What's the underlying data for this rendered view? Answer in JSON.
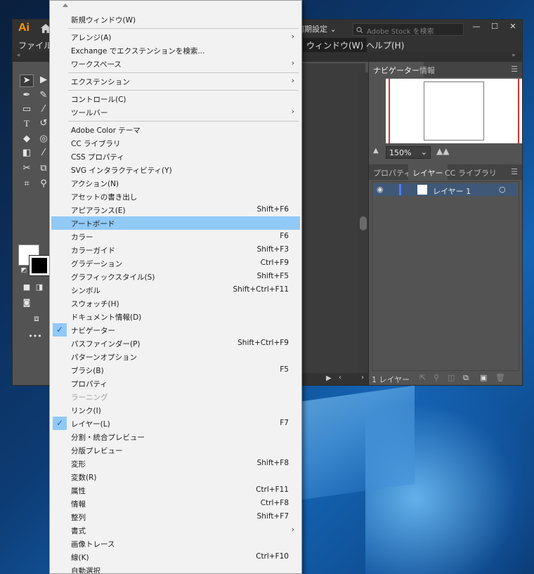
{
  "app": {
    "logo": "Ai",
    "workspace": "初期設定",
    "stock_search_placeholder": "Adobe Stock を検索",
    "menu_file": "ファイル",
    "menu_window": "ウィンドウ(W)",
    "menu_help": "ヘルプ(H)",
    "win_min": "—",
    "win_max": "☐",
    "win_close": "✕"
  },
  "panels": {
    "top_tabs": [
      "ナビゲーター",
      "情報"
    ],
    "zoom": "150%",
    "bottom_tabs": [
      "プロパティ",
      "レイヤー",
      "CC ライブラリ"
    ],
    "layer_name": "レイヤー 1",
    "layer_count": "1 レイヤー"
  },
  "menu": {
    "items": [
      {
        "label": "新規ウィンドウ(W)",
        "shortcut": ""
      },
      {
        "label": "アレンジ(A)",
        "shortcut": "",
        "submenu": true
      },
      {
        "label": "Exchange でエクステンションを検索...",
        "shortcut": ""
      },
      {
        "label": "ワークスペース",
        "shortcut": "",
        "submenu": true
      },
      {
        "label": "エクステンション",
        "shortcut": "",
        "submenu": true
      },
      {
        "label": "コントロール(C)",
        "shortcut": ""
      },
      {
        "label": "ツールバー",
        "shortcut": "",
        "submenu": true
      },
      {
        "label": "Adobe Color テーマ",
        "shortcut": ""
      },
      {
        "label": "CC ライブラリ",
        "shortcut": ""
      },
      {
        "label": "CSS プロパティ",
        "shortcut": ""
      },
      {
        "label": "SVG インタラクティビティ(Y)",
        "shortcut": ""
      },
      {
        "label": "アクション(N)",
        "shortcut": ""
      },
      {
        "label": "アセットの書き出し",
        "shortcut": ""
      },
      {
        "label": "アピアランス(E)",
        "shortcut": "Shift+F6"
      },
      {
        "label": "アートボード",
        "shortcut": "",
        "highlighted": true
      },
      {
        "label": "カラー",
        "shortcut": "F6"
      },
      {
        "label": "カラーガイド",
        "shortcut": "Shift+F3"
      },
      {
        "label": "グラデーション",
        "shortcut": "Ctrl+F9"
      },
      {
        "label": "グラフィックスタイル(S)",
        "shortcut": "Shift+F5"
      },
      {
        "label": "シンボル",
        "shortcut": "Shift+Ctrl+F11"
      },
      {
        "label": "スウォッチ(H)",
        "shortcut": ""
      },
      {
        "label": "ドキュメント情報(D)",
        "shortcut": ""
      },
      {
        "label": "ナビゲーター",
        "shortcut": "",
        "checked": true
      },
      {
        "label": "パスファインダー(P)",
        "shortcut": "Shift+Ctrl+F9"
      },
      {
        "label": "パターンオプション",
        "shortcut": ""
      },
      {
        "label": "ブラシ(B)",
        "shortcut": "F5"
      },
      {
        "label": "プロパティ",
        "shortcut": ""
      },
      {
        "label": "ラーニング",
        "shortcut": "",
        "disabled": true
      },
      {
        "label": "リンク(I)",
        "shortcut": ""
      },
      {
        "label": "レイヤー(L)",
        "shortcut": "F7",
        "checked": true
      },
      {
        "label": "分割・統合プレビュー",
        "shortcut": ""
      },
      {
        "label": "分版プレビュー",
        "shortcut": ""
      },
      {
        "label": "変形",
        "shortcut": "Shift+F8"
      },
      {
        "label": "変数(R)",
        "shortcut": ""
      },
      {
        "label": "属性",
        "shortcut": "Ctrl+F11"
      },
      {
        "label": "情報",
        "shortcut": "Ctrl+F8"
      },
      {
        "label": "整列",
        "shortcut": "Shift+F7"
      },
      {
        "label": "書式",
        "shortcut": "",
        "submenu": true
      },
      {
        "label": "画像トレース",
        "shortcut": ""
      },
      {
        "label": "線(K)",
        "shortcut": "Ctrl+F10"
      },
      {
        "label": "自動選択",
        "shortcut": ""
      }
    ]
  }
}
